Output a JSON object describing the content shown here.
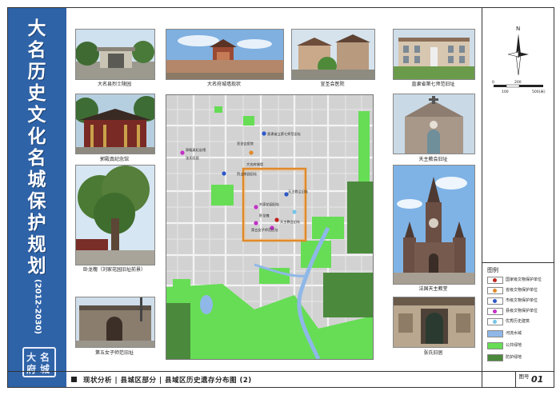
{
  "sidebar": {
    "title_chars": [
      "大",
      "名",
      "历",
      "史",
      "文",
      "化",
      "名",
      "城",
      "保",
      "护",
      "规",
      "划"
    ],
    "years": "(2012-2030)",
    "seal_chars": [
      "大",
      "名",
      "府",
      "城"
    ]
  },
  "photos": [
    {
      "caption": "大名县烈士陵园"
    },
    {
      "caption": "大名府城墙现状"
    },
    {
      "caption": "宣圣会医院"
    },
    {
      "caption": "直隶省第七师范旧址"
    },
    {
      "caption": "郭殿真纪念馆"
    },
    {
      "caption": "天主教会旧址"
    },
    {
      "caption": "卧龙槐（刘家花园旧址前景）"
    },
    {
      "caption": "法国天主教堂"
    },
    {
      "caption": "第五女子师范旧址"
    },
    {
      "caption": "张氏旧居"
    }
  ],
  "map_labels": [
    "直隶省立第七师范旧址",
    "郭殿真纪念馆",
    "天主教会旧址",
    "烈士陵园旧址",
    "刘家花园旧址",
    "天主教会旧址",
    "卧龙槐",
    "第五女子师范旧址",
    "大名府城墙",
    "张氏旧居",
    "宣圣会医院"
  ],
  "compass": {
    "north": "N"
  },
  "scale": {
    "labels": [
      "0",
      "200",
      "100",
      "500(米)"
    ]
  },
  "legend": {
    "title": "图例",
    "items": [
      {
        "label": "国家级文物保护单位",
        "color": "#c0221c",
        "kind": "dot"
      },
      {
        "label": "省级文物保护单位",
        "color": "#e08a2a",
        "kind": "dot"
      },
      {
        "label": "市级文物保护单位",
        "color": "#2e58c9",
        "kind": "dot"
      },
      {
        "label": "县级文物保护单位",
        "color": "#c42fc8",
        "kind": "dot"
      },
      {
        "label": "优秀历史建筑",
        "color": "#74c4e8",
        "kind": "dot"
      },
      {
        "label": "河流水域",
        "color": "#8fb8e8",
        "kind": "fill"
      },
      {
        "label": "公共绿地",
        "color": "#66dd55",
        "kind": "fill"
      },
      {
        "label": "防护绿地",
        "color": "#4b8a3c",
        "kind": "fill"
      }
    ]
  },
  "footer": {
    "title": "现状分析 | 县城区部分 | 县域区历史遗存分布图 (2)",
    "fig_label": "图号",
    "fig_number": "01"
  }
}
